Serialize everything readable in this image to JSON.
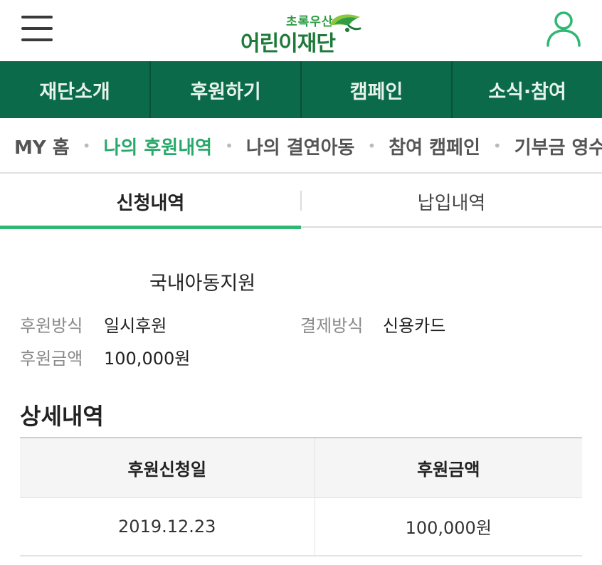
{
  "header": {
    "logo_sub": "초록우산",
    "logo_main": "어린이재단",
    "brand_color": "#1e7a3a"
  },
  "gnb": {
    "color": "#0b6a4a",
    "items": [
      "재단소개",
      "후원하기",
      "캠페인",
      "소식·참여"
    ]
  },
  "subnav": {
    "items": [
      {
        "label": "MY 홈",
        "active": false
      },
      {
        "label": "나의 후원내역",
        "active": true
      },
      {
        "label": "나의 결연아동",
        "active": false
      },
      {
        "label": "참여 캠페인",
        "active": false
      },
      {
        "label": "기부금 영수증",
        "active": false
      }
    ],
    "separator": "•",
    "active_color": "#28a86a"
  },
  "tabs": {
    "left": "신청내역",
    "right": "납입내역",
    "indicator_color": "#2eb872"
  },
  "summary": {
    "program": "국내아동지원",
    "method_label": "후원방식",
    "method_value": "일시후원",
    "payment_label": "결제방식",
    "payment_value": "신용카드",
    "amount_label": "후원금액",
    "amount_value": "100,000원"
  },
  "detail": {
    "title": "상세내역",
    "columns": [
      "후원신청일",
      "후원금액"
    ],
    "rows": [
      [
        "2019.12.23",
        "100,000원"
      ]
    ]
  }
}
